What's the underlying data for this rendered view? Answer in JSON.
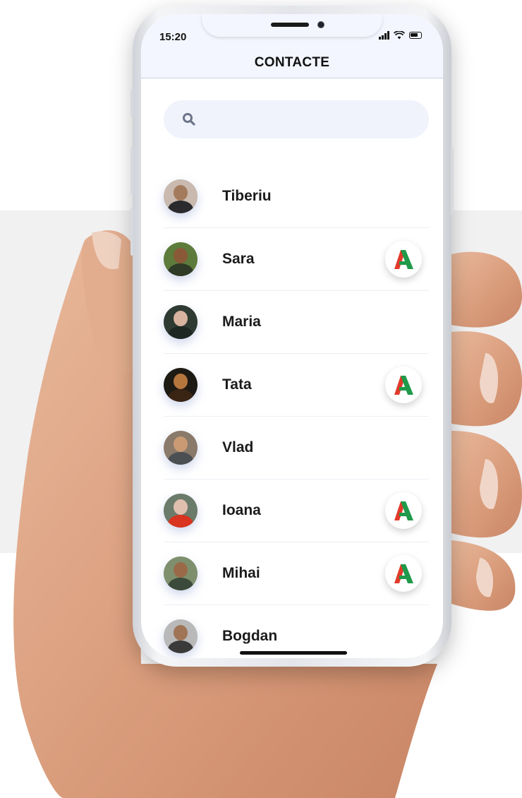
{
  "status_bar": {
    "time": "15:20"
  },
  "header": {
    "title": "CONTACTE"
  },
  "search": {
    "placeholder": ""
  },
  "contacts": [
    {
      "name": "Tiberiu",
      "has_app_badge": false,
      "avatar_bg": "#c9b9ae",
      "avatar_head": "#a47a5c",
      "avatar_body": "#2b2b2e"
    },
    {
      "name": "Sara",
      "has_app_badge": true,
      "avatar_bg": "#5d7b3a",
      "avatar_head": "#8a5a38",
      "avatar_body": "#2f3b26"
    },
    {
      "name": "Maria",
      "has_app_badge": false,
      "avatar_bg": "#2e3a32",
      "avatar_head": "#d8b3a0",
      "avatar_body": "#1e2722"
    },
    {
      "name": "Tata",
      "has_app_badge": true,
      "avatar_bg": "#1d1a14",
      "avatar_head": "#b5763e",
      "avatar_body": "#3a2414"
    },
    {
      "name": "Vlad",
      "has_app_badge": false,
      "avatar_bg": "#8a7a6a",
      "avatar_head": "#c99a74",
      "avatar_body": "#4c4f52"
    },
    {
      "name": "Ioana",
      "has_app_badge": true,
      "avatar_bg": "#6b7b6a",
      "avatar_head": "#e0bfae",
      "avatar_body": "#d8341f"
    },
    {
      "name": "Mihai",
      "has_app_badge": true,
      "avatar_bg": "#7e8f6e",
      "avatar_head": "#9a6a48",
      "avatar_body": "#3b4a3a"
    },
    {
      "name": "Bogdan",
      "has_app_badge": false,
      "avatar_bg": "#b9b9b9",
      "avatar_head": "#a07456",
      "avatar_body": "#3a3a3a"
    }
  ],
  "colors": {
    "badge_red": "#e23a2b",
    "badge_green": "#1f9a4a",
    "search_bg": "#f0f3fc",
    "header_bg": "#f3f6fe"
  }
}
